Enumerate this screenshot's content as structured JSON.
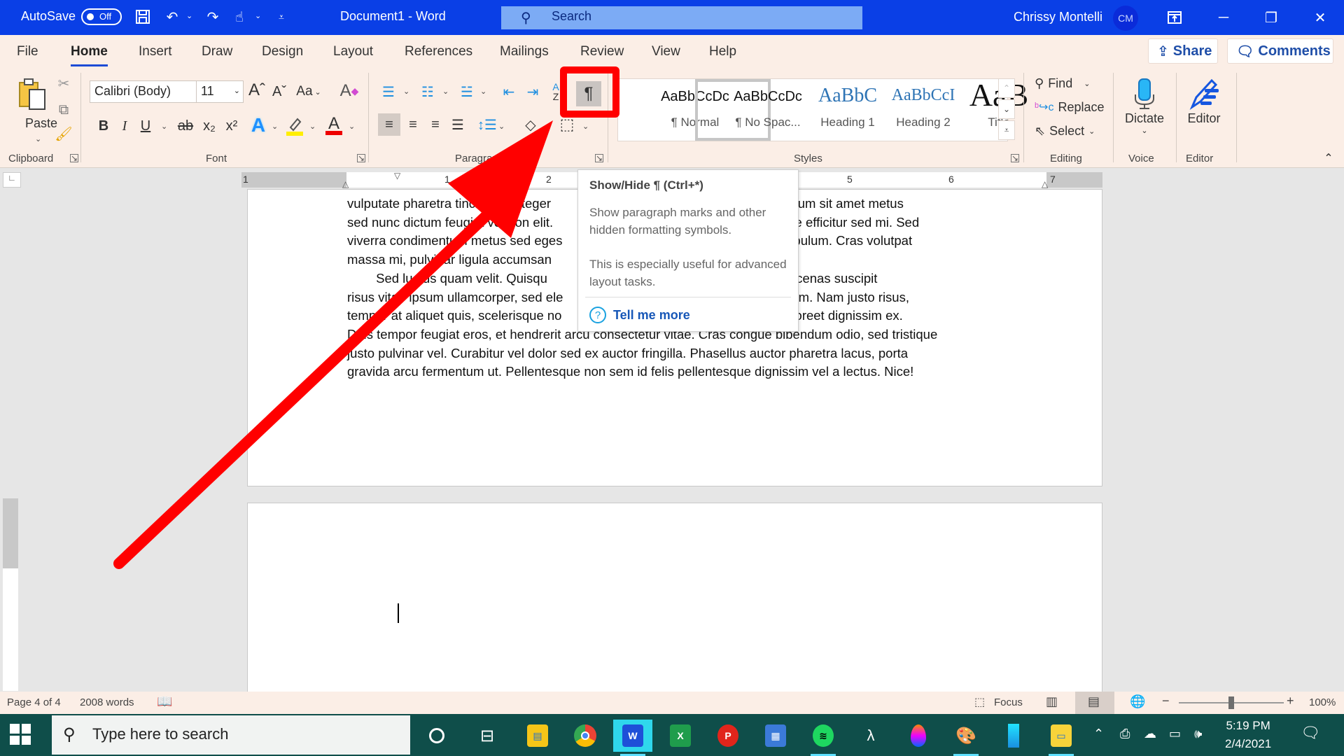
{
  "titlebar": {
    "autosave_label": "AutoSave",
    "autosave_state": "Off",
    "doc_title": "Document1  -  Word",
    "search_placeholder": "Search",
    "user_name": "Chrissy Montelli",
    "user_initials": "CM",
    "quick_access": [
      "save-icon",
      "undo-icon",
      "redo-icon",
      "touch-mode-icon",
      "customize-icon"
    ],
    "window_controls": [
      "ribbon-display-icon",
      "minimize-icon",
      "restore-icon",
      "close-icon"
    ]
  },
  "tabs": [
    {
      "label": "File",
      "active": false
    },
    {
      "label": "Home",
      "active": true
    },
    {
      "label": "Insert",
      "active": false
    },
    {
      "label": "Draw",
      "active": false
    },
    {
      "label": "Design",
      "active": false
    },
    {
      "label": "Layout",
      "active": false
    },
    {
      "label": "References",
      "active": false
    },
    {
      "label": "Mailings",
      "active": false
    },
    {
      "label": "Review",
      "active": false
    },
    {
      "label": "View",
      "active": false
    },
    {
      "label": "Help",
      "active": false
    }
  ],
  "share_label": "Share",
  "comments_label": "Comments",
  "ribbon": {
    "clipboard": {
      "label": "Clipboard",
      "paste_label": "Paste"
    },
    "font": {
      "label": "Font",
      "font_name": "Calibri (Body)",
      "font_size": "11",
      "change_case": "Aa",
      "bold": "B",
      "italic": "I",
      "underline": "U",
      "strikethrough": "ab",
      "subscript": "x₂",
      "superscript": "x²"
    },
    "paragraph": {
      "label": "Paragraph",
      "show_hide_glyph": "¶"
    },
    "styles": {
      "label": "Styles",
      "items": [
        {
          "sample": "AaBbCcDc",
          "name": "¶ Normal",
          "selected": false
        },
        {
          "sample": "AaBbCcDc",
          "name": "¶ No Spac...",
          "selected": true
        },
        {
          "sample": "AaBbC",
          "name": "Heading 1",
          "selected": false
        },
        {
          "sample": "AaBbCcI",
          "name": "Heading 2",
          "selected": false
        },
        {
          "sample": "AaB",
          "name": "Title",
          "selected": false
        }
      ]
    },
    "editing": {
      "label": "Editing",
      "find": "Find",
      "replace": "Replace",
      "select": "Select"
    },
    "voice": {
      "label": "Voice",
      "dictate": "Dictate"
    },
    "editor": {
      "label": "Editor",
      "editor": "Editor"
    }
  },
  "ruler": {
    "numbers": [
      "1",
      "1",
      "2",
      "5",
      "6",
      "7"
    ]
  },
  "document": {
    "paragraph1": "vulputate pharetra tincidunt. Integer                                                 pat. Vestibulum sit amet metus\nsed nunc dictum feugiat vel non elit.                                                  sque ornare efficitur sed mi. Sed\nviverra condimentum metus sed eges                                                     id vestibulum. Cras volutpat\nmassa mi, pulvinar ligula accumsan",
    "paragraph2": "        Sed luctus quam velit. Quisqu                                              s efficitur. Maecenas suscipit\nrisus vitae ipsum ullamcorper, sed ele                                               lapibus quam. Nam justo risus,\ntempor at aliquet quis, scelerisque no                                              c velit ac, laoreet dignissim ex.\nDuis tempor feugiat eros, et hendrerit arcu consectetur vitae. Cras congue bibendum odio, sed tristique\njusto pulvinar vel. Curabitur vel dolor sed ex auctor fringilla. Phasellus auctor pharetra lacus, porta\ngravida arcu fermentum ut. Pellentesque non sem id felis pellentesque dignissim vel a lectus. Nice!"
  },
  "tooltip": {
    "title": "Show/Hide ¶ (Ctrl+*)",
    "description": "Show paragraph marks and other hidden formatting symbols.",
    "note": "This is especially useful for advanced layout tasks.",
    "link": "Tell me more"
  },
  "statusbar": {
    "page": "Page 4 of 4",
    "words": "2008 words",
    "focus": "Focus",
    "zoom_level": "100%",
    "zoom_fraction": 0.5
  },
  "taskbar": {
    "search_placeholder": "Type here to search",
    "time": "5:19 PM",
    "date": "2/4/2021",
    "apps": [
      "cortana",
      "task-view",
      "file-explorer-doc",
      "chrome",
      "word",
      "excel",
      "powerpoint",
      "calculator",
      "spotify",
      "lambda-app",
      "paint-drop",
      "paint",
      "notepad-app",
      "file-explorer"
    ]
  },
  "colors": {
    "titlebar": "#0a3fe6",
    "ribbon_bg": "#fbeee6",
    "annotation_red": "#ff0000",
    "link_blue": "#1757b7",
    "taskbar": "#0f4e4a"
  }
}
